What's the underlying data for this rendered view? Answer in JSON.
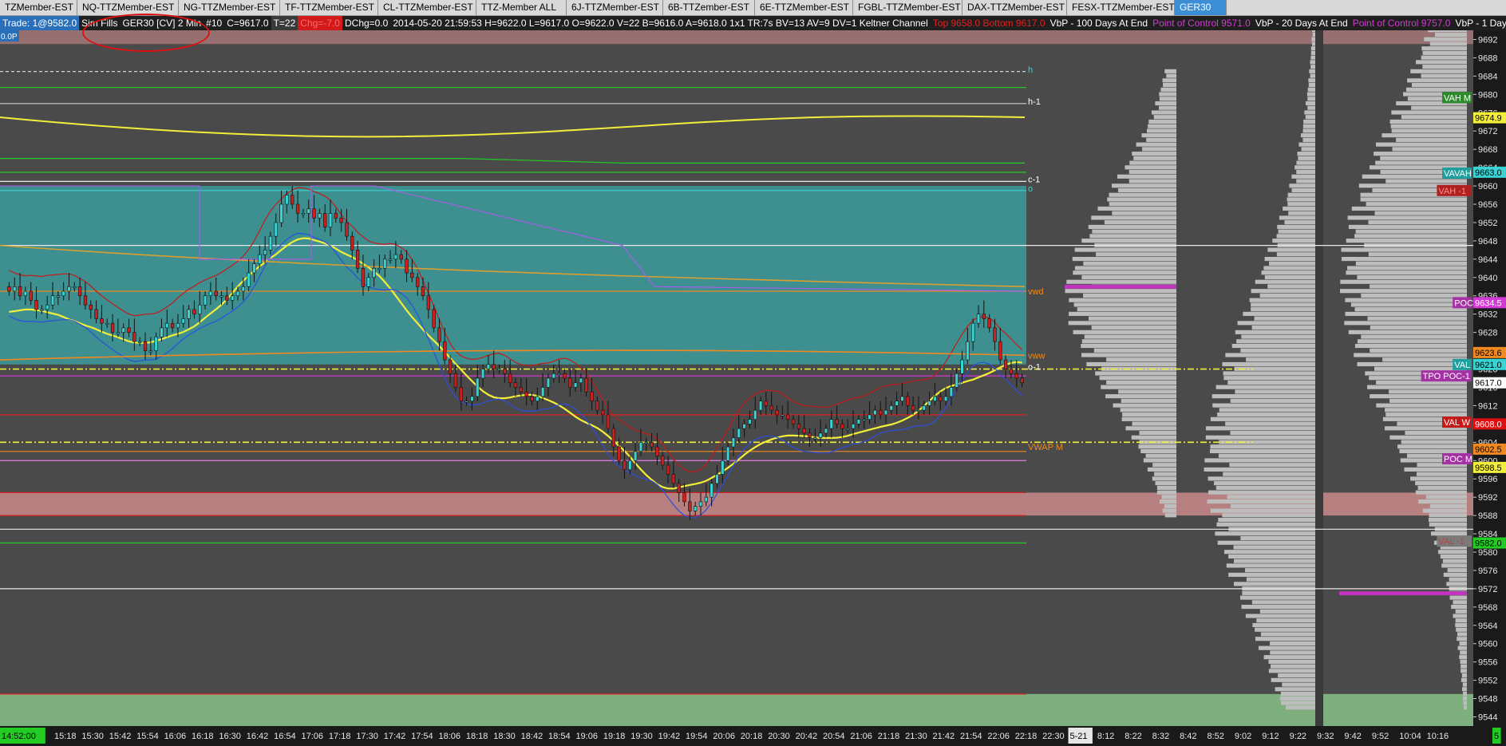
{
  "tabs": [
    {
      "label": "TZMember-EST",
      "w": 84
    },
    {
      "label": "NQ-TTZMember-EST",
      "w": 114
    },
    {
      "label": "NG-TTZMember-EST",
      "w": 114
    },
    {
      "label": "TF-TTZMember-EST",
      "w": 110
    },
    {
      "label": "CL-TTZMember-EST",
      "w": 110
    },
    {
      "label": "TTZ-Member ALL",
      "w": 100
    },
    {
      "label": "6J-TTZMember-EST",
      "w": 108
    },
    {
      "label": "6B-TTZember-EST",
      "w": 102
    },
    {
      "label": "6E-TTZMember-EST",
      "w": 110
    },
    {
      "label": "FGBL-TTZMember-EST",
      "w": 124
    },
    {
      "label": "DAX-TTZMember-EST",
      "w": 118
    },
    {
      "label": "FESX-TTZMember-EST",
      "w": 122
    },
    {
      "label": "GER30",
      "w": 52,
      "active": true
    }
  ],
  "info_items": [
    {
      "text": "Trade: 1@9582.0",
      "bg": "#2a6fba",
      "fg": "#ffffff"
    },
    {
      "text": "Sim Fills",
      "bg": "transparent",
      "fg": "#ffffff"
    },
    {
      "text": "GER30 [CV]  2 Min",
      "bg": "transparent",
      "fg": "#ffffff"
    },
    {
      "text": "#10",
      "bg": "transparent",
      "fg": "#ffffff"
    },
    {
      "text": "C=9617.0",
      "bg": "transparent",
      "fg": "#ffffff"
    },
    {
      "text": "T=22",
      "bg": "#3a3a3a",
      "fg": "#ffffff"
    },
    {
      "text": "Chg=-7.0",
      "bg": "#d21a1a",
      "fg": "#ff6a6a"
    },
    {
      "text": "DChg=0.0",
      "bg": "transparent",
      "fg": "#ffffff"
    },
    {
      "text": "2014-05-20  21:59:53  H=9622.0  L=9617.0  O=9622.0  V=22  B=9616.0  A=9618.0  1x1  TR:7s  BV=13  AV=9  DV=1  Keltner Channel",
      "bg": "transparent",
      "fg": "#ffffff"
    },
    {
      "text": "Top 9658.0  Bottom 9617.0",
      "bg": "transparent",
      "fg": "#e02020"
    },
    {
      "text": "VbP - 100 Days At End",
      "bg": "transparent",
      "fg": "#ffffff"
    },
    {
      "text": "Point of Control 9571.0",
      "bg": "transparent",
      "fg": "#d33ad3"
    },
    {
      "text": "VbP - 20 Days At End",
      "bg": "transparent",
      "fg": "#ffffff"
    },
    {
      "text": "Point of Control 9757.0",
      "bg": "transparent",
      "fg": "#d33ad3"
    },
    {
      "text": "VbP - 1 Days At End",
      "bg": "transparent",
      "fg": "#ffffff"
    }
  ],
  "corner_label": "0.0P",
  "chart_data": {
    "type": "candlestick",
    "symbol": "GER30",
    "interval": "2 Min",
    "ylim": [
      9542,
      9694
    ],
    "y_ticks": [
      9692,
      9688,
      9684,
      9680,
      9676,
      9672,
      9668,
      9664,
      9660,
      9656,
      9652,
      9648,
      9644,
      9640,
      9636,
      9632,
      9628,
      9624,
      9620,
      9616,
      9612,
      9608,
      9604,
      9600,
      9596,
      9592,
      9588,
      9584,
      9580,
      9576,
      9572,
      9568,
      9564,
      9560,
      9556,
      9552,
      9548,
      9544
    ],
    "x_labels": [
      "14:52:00",
      "15:18",
      "15:30",
      "15:42",
      "15:54",
      "16:06",
      "16:18",
      "16:30",
      "16:42",
      "16:54",
      "17:06",
      "17:18",
      "17:30",
      "17:42",
      "17:54",
      "18:06",
      "18:18",
      "18:30",
      "18:42",
      "18:54",
      "19:06",
      "19:18",
      "19:30",
      "19:42",
      "19:54",
      "20:06",
      "20:18",
      "20:30",
      "20:42",
      "20:54",
      "21:06",
      "21:18",
      "21:30",
      "21:42",
      "21:54",
      "22:06",
      "22:18",
      "22:30",
      "5-21",
      "8:12",
      "8:22",
      "8:32",
      "8:42",
      "8:52",
      "9:02",
      "9:12",
      "9:22",
      "9:32",
      "9:42",
      "9:52",
      "10:04",
      "10:16",
      "5"
    ],
    "candle_closes": [
      9637,
      9638,
      9636,
      9637,
      9635,
      9633,
      9633,
      9634,
      9636,
      9636,
      9637,
      9638,
      9638,
      9636,
      9634,
      9633,
      9631,
      9630,
      9630,
      9628,
      9628,
      9629,
      9628,
      9626,
      9626,
      9624,
      9624,
      9627,
      9629,
      9630,
      9629,
      9630,
      9631,
      9633,
      9632,
      9634,
      9636,
      9637,
      9636,
      9636,
      9635,
      9636,
      9637,
      9638,
      9641,
      9643,
      9645,
      9646,
      9649,
      9652,
      9656,
      9658,
      9656,
      9654,
      9654,
      9655,
      9653,
      9654,
      9651,
      9654,
      9653,
      9652,
      9649,
      9646,
      9642,
      9638,
      9640,
      9642,
      9642,
      9644,
      9644,
      9645,
      9644,
      9641,
      9640,
      9638,
      9636,
      9633,
      9629,
      9626,
      9622,
      9619,
      9616,
      9613,
      9613,
      9614,
      9618,
      9620,
      9621,
      9620,
      9620,
      9619,
      9617,
      9616,
      9615,
      9614,
      9613,
      9614,
      9616,
      9618,
      9619,
      9619,
      9618,
      9616,
      9617,
      9618,
      9615,
      9613,
      9611,
      9610,
      9607,
      9603,
      9600,
      9598,
      9600,
      9602,
      9604,
      9604,
      9603,
      9601,
      9599,
      9597,
      9595,
      9593,
      9591,
      9589,
      9590,
      9591,
      9592,
      9595,
      9597,
      9600,
      9603,
      9605,
      9607,
      9608,
      9609,
      9611,
      9613,
      9612,
      9611,
      9610,
      9610,
      9609,
      9608,
      9607,
      9606,
      9605,
      9605,
      9606,
      9607,
      9609,
      9608,
      9607,
      9607,
      9608,
      9609,
      9609,
      9610,
      9611,
      9610,
      9611,
      9612,
      9613,
      9614,
      9612,
      9611,
      9611,
      9612,
      9613,
      9614,
      9613,
      9614,
      9616,
      9619,
      9622,
      9626,
      9630,
      9632,
      9631,
      9629,
      9626,
      9622,
      9620,
      9619,
      9618,
      9617
    ],
    "right_labels": [
      {
        "text": "VAH M",
        "price": 9679.3,
        "bg": "#2d8a2d",
        "fg": "#ffffff"
      },
      {
        "text": "9674.9",
        "price": 9674.9,
        "bg": "#f2ee3a",
        "fg": "#000000"
      },
      {
        "text": "VAVAH",
        "price": 9662.8,
        "bg": "#1f9e9e",
        "fg": "#ffffff"
      },
      {
        "text": "9663.0",
        "price": 9663.0,
        "bg": "#3ad3d3",
        "fg": "#000000"
      },
      {
        "text": "VAH -1",
        "price": 9659.0,
        "bg": "#b02020",
        "fg": "#ff9090"
      },
      {
        "text": "POC",
        "price": 9634.5,
        "bg": "#a532a5",
        "fg": "#ffffff"
      },
      {
        "text": "9634.5",
        "price": 9634.5,
        "bg": "#d33ad3",
        "fg": "#ffffff"
      },
      {
        "text": "9623.6",
        "price": 9623.6,
        "bg": "#f08a20",
        "fg": "#000000"
      },
      {
        "text": "VAL",
        "price": 9621.0,
        "bg": "#1f9e9e",
        "fg": "#ffffff"
      },
      {
        "text": "9621.0",
        "price": 9621.0,
        "bg": "#3ad3d3",
        "fg": "#000000"
      },
      {
        "text": "TPO POC-1",
        "price": 9618.5,
        "bg": "#a532a5",
        "fg": "#ffffff"
      },
      {
        "text": "9617.0",
        "price": 9617.0,
        "bg": "#ffffff",
        "fg": "#000000"
      },
      {
        "text": "VAL W",
        "price": 9608.4,
        "bg": "#c41a1a",
        "fg": "#ffffff"
      },
      {
        "text": "9608.0",
        "price": 9608.0,
        "bg": "#e01010",
        "fg": "#ffffff"
      },
      {
        "text": "9602.5",
        "price": 9602.5,
        "bg": "#f08a20",
        "fg": "#000000"
      },
      {
        "text": "POC M",
        "price": 9600.4,
        "bg": "#a532a5",
        "fg": "#ffffff"
      },
      {
        "text": "9598.5",
        "price": 9598.5,
        "bg": "#f2ee3a",
        "fg": "#000000"
      },
      {
        "text": "VAL -1",
        "price": 9582.4,
        "bg": "#7a7a7a",
        "fg": "#c04040"
      },
      {
        "text": "9582.0",
        "price": 9582.0,
        "bg": "#22cc22",
        "fg": "#000000"
      }
    ],
    "line_labels": [
      {
        "text": "h",
        "price": 9685.5,
        "color": "#3ad3d3"
      },
      {
        "text": "h-1",
        "price": 9678.5,
        "color": "#ffffff"
      },
      {
        "text": "c-1",
        "price": 9661.5,
        "color": "#ffffff"
      },
      {
        "text": "o",
        "price": 9659.5,
        "color": "#3ad3d3"
      },
      {
        "text": "vwd",
        "price": 9637.0,
        "color": "#f08a20"
      },
      {
        "text": "vww",
        "price": 9623.0,
        "color": "#f08a20"
      },
      {
        "text": "o-1",
        "price": 9620.5,
        "color": "#ffffff"
      },
      {
        "text": "VWAP M",
        "price": 9603.0,
        "color": "#f08a20"
      }
    ],
    "horizontal_levels": [
      {
        "price": 9685.0,
        "color": "#d0d0d0",
        "style": "dash"
      },
      {
        "price": 9681.5,
        "color": "#22cc22",
        "style": "solid"
      },
      {
        "price": 9678.0,
        "color": "#d0d0d0",
        "style": "solid"
      },
      {
        "price": 9663.0,
        "color": "#22cc22",
        "style": "solid"
      },
      {
        "price": 9661.0,
        "color": "#ffffff",
        "style": "solid"
      },
      {
        "price": 9659.0,
        "color": "#3ad3d3",
        "style": "solid"
      },
      {
        "price": 9647.0,
        "color": "#e8e8e8",
        "style": "solid"
      },
      {
        "price": 9637.0,
        "color": "#f08a20",
        "style": "solid"
      },
      {
        "price": 9620.0,
        "color": "#f2ee3a",
        "style": "dashdot"
      },
      {
        "price": 9618.5,
        "color": "#d33ad3",
        "style": "solid"
      },
      {
        "price": 9610.0,
        "color": "#e02020",
        "style": "solid"
      },
      {
        "price": 9604.0,
        "color": "#f2ee3a",
        "style": "dashdot"
      },
      {
        "price": 9602.0,
        "color": "#f08a20",
        "style": "solid"
      },
      {
        "price": 9600.0,
        "color": "#e87ae8",
        "style": "solid"
      },
      {
        "price": 9593.0,
        "color": "#e02020",
        "style": "solid"
      },
      {
        "price": 9588.0,
        "color": "#e02020",
        "style": "solid"
      },
      {
        "price": 9585.0,
        "color": "#e8e8e8",
        "style": "solid"
      },
      {
        "price": 9582.0,
        "color": "#22cc22",
        "style": "solid"
      },
      {
        "price": 9572.0,
        "color": "#e8e8e8",
        "style": "solid"
      },
      {
        "price": 9549.0,
        "color": "#e02020",
        "style": "solid"
      }
    ],
    "colors": {
      "bull": "#3ad3d3",
      "bear": "#cc1f1f",
      "teal_zone": "#3e8f8f",
      "pink_zone": "#c98a8a",
      "green_zone": "#7fae7f",
      "axis_bg": "#1a1a1a",
      "volume_profile": "#bdbdbd",
      "poc": "#c034c0"
    }
  }
}
